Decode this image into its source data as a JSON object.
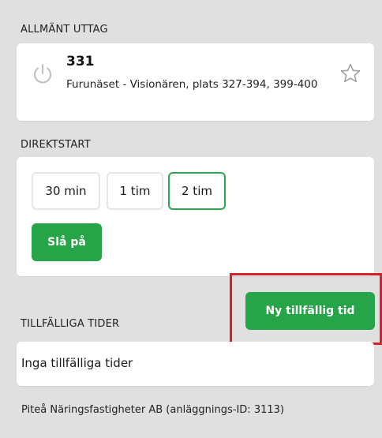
{
  "outlet": {
    "section_label": "ALLMÄNT UTTAG",
    "number": "331",
    "address": "Furunäset - Visionären, plats 327-394, 399-400",
    "icons": {
      "power": "power-icon",
      "favorite": "star-icon"
    }
  },
  "direct_start": {
    "section_label": "DIREKTSTART",
    "durations": [
      "30 min",
      "1 tim",
      "2 tim"
    ],
    "selected_duration": "2 tim",
    "start_label": "Slå på"
  },
  "temporary": {
    "new_button_label": "Ny tillfällig tid",
    "section_label": "TILLFÄLLIGA TIDER",
    "empty_text": "Inga tillfälliga tider"
  },
  "footer": {
    "text": "Piteå Näringsfastigheter AB (anläggnings-ID: 3113)"
  },
  "colors": {
    "background": "#e0e0e0",
    "card": "#ffffff",
    "accent_green": "#27a348",
    "selected_border": "#2ea44f",
    "highlight_red": "#d4212a"
  }
}
